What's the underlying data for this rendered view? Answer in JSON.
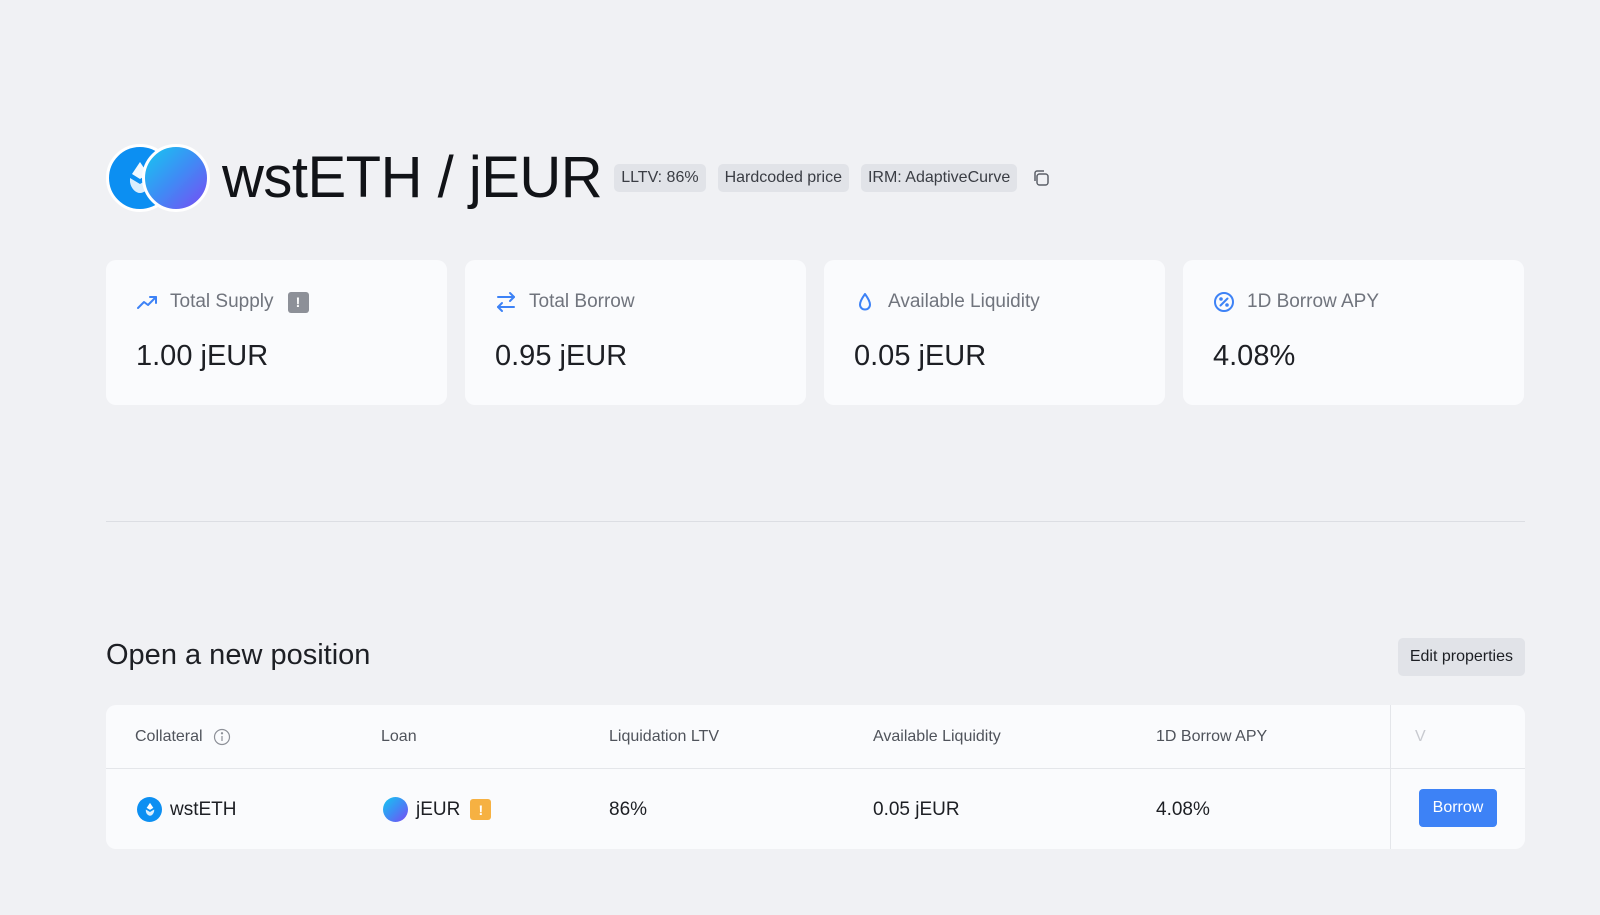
{
  "header": {
    "title": "wstETH / jEUR",
    "tags": [
      "LLTV: 86%",
      "Hardcoded price",
      "IRM: AdaptiveCurve"
    ],
    "collateral_logo_icon": "wsteth-logo-icon",
    "loan_logo_icon": "jeur-logo-icon",
    "copy_icon": "copy-icon"
  },
  "stats": [
    {
      "label": "Total Supply",
      "value": "1.00 jEUR",
      "icon": "trending-up-icon",
      "warning": "!"
    },
    {
      "label": "Total Borrow",
      "value": "0.95 jEUR",
      "icon": "swap-arrows-icon"
    },
    {
      "label": "Available Liquidity",
      "value": "0.05 jEUR",
      "icon": "droplet-icon"
    },
    {
      "label": "1D Borrow APY",
      "value": "4.08%",
      "icon": "percent-circle-icon"
    }
  ],
  "position": {
    "title": "Open a new position",
    "edit_label": "Edit properties",
    "columns": [
      "Collateral",
      "Loan",
      "Liquidation LTV",
      "Available Liquidity",
      "1D Borrow APY",
      "V"
    ],
    "row": {
      "collateral": "wstETH",
      "loan": "jEUR",
      "loan_warning": "!",
      "lltv": "86%",
      "liquidity": "0.05 jEUR",
      "apy": "4.08%",
      "action": "Borrow"
    }
  },
  "colors": {
    "accent": "#3d82f6",
    "background": "#f0f1f4",
    "card": "#fafbfd",
    "warning": "#f6b142"
  }
}
